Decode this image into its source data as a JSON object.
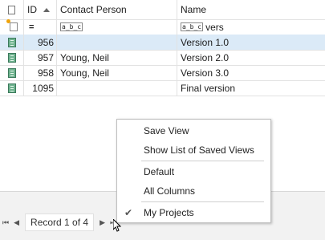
{
  "grid": {
    "headers": {
      "id": "ID",
      "contact": "Contact Person",
      "name": "Name"
    },
    "filter_row": {
      "id_op": "=",
      "abc_label": "a̲b̲c",
      "name_filter": "vers"
    },
    "rows": [
      {
        "id": "956",
        "contact": "",
        "name": "Version 1.0",
        "selected": true
      },
      {
        "id": "957",
        "contact": "Young, Neil",
        "name": "Version 2.0",
        "selected": false
      },
      {
        "id": "958",
        "contact": "Young, Neil",
        "name": "Version 3.0",
        "selected": false
      },
      {
        "id": "1095",
        "contact": "",
        "name": "Final version",
        "selected": false
      }
    ]
  },
  "navigator": {
    "first": "⏮",
    "prev": "◀",
    "record_text": "Record 1 of 4",
    "next": "▶",
    "last": "⏭"
  },
  "context_menu": {
    "items": [
      {
        "label": "Save View"
      },
      {
        "label": "Show List of Saved Views"
      },
      {
        "label": "Default"
      },
      {
        "label": "All Columns"
      },
      {
        "label": "My Projects",
        "checked": true
      }
    ],
    "check_glyph": "✔"
  }
}
